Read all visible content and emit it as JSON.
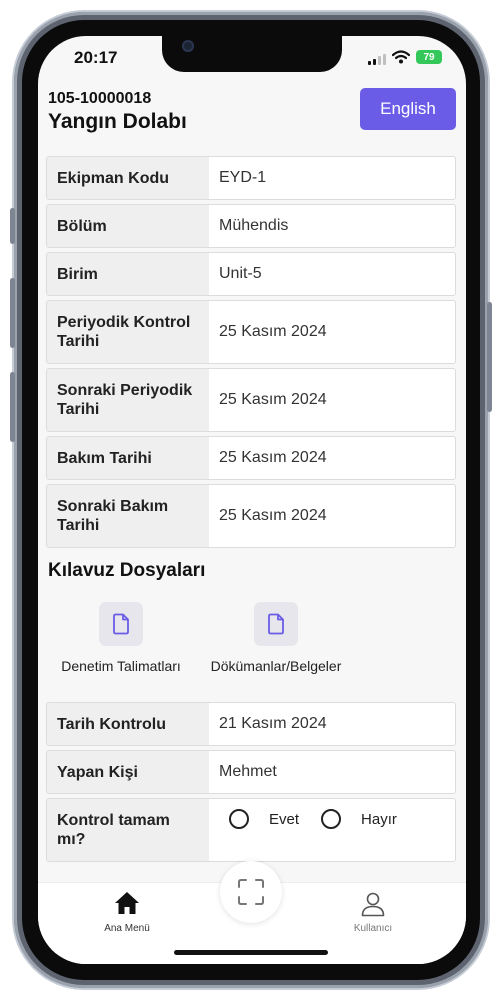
{
  "status": {
    "time": "20:17",
    "battery": "79"
  },
  "header": {
    "code": "105-10000018",
    "title": "Yangın Dolabı",
    "language_button": "English"
  },
  "details": [
    {
      "label": "Ekipman Kodu",
      "value": "EYD-1"
    },
    {
      "label": "Bölüm",
      "value": "Mühendis"
    },
    {
      "label": "Birim",
      "value": "Unit-5"
    },
    {
      "label": "Periyodik Kontrol Tarihi",
      "value": "25 Kasım 2024"
    },
    {
      "label": "Sonraki Periyodik Tarihi",
      "value": "25 Kasım 2024"
    },
    {
      "label": "Bakım Tarihi",
      "value": "25 Kasım 2024"
    },
    {
      "label": "Sonraki Bakım Tarihi",
      "value": "25 Kasım 2024"
    }
  ],
  "guides": {
    "title": "Kılavuz Dosyaları",
    "items": [
      {
        "label": "Denetim Talimatları",
        "icon": "file-icon"
      },
      {
        "label": "Dökümanlar/Belgeler",
        "icon": "file-icon"
      }
    ]
  },
  "control": [
    {
      "label": "Tarih Kontrolu",
      "value": "21 Kasım 2024"
    },
    {
      "label": "Yapan Kişi",
      "value": "Mehmet"
    }
  ],
  "completion": {
    "label": "Kontrol tamam mı?",
    "yes": "Evet",
    "no": "Hayır"
  },
  "tabbar": {
    "home": "Ana Menü",
    "user": "Kullanıcı",
    "scan_icon": "scan-icon"
  },
  "colors": {
    "accent": "#6b5ce7",
    "label_bg": "#efefef",
    "battery": "#34c759"
  }
}
